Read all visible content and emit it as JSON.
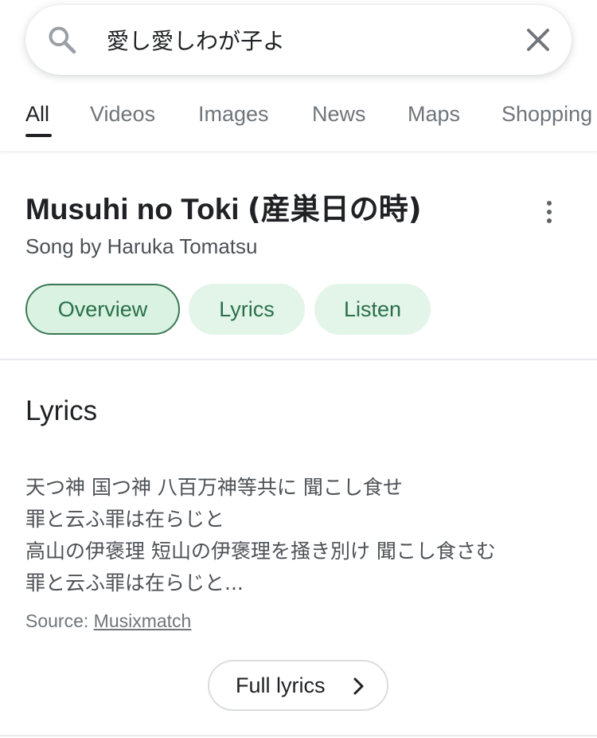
{
  "search": {
    "value": "愛し愛しわが子よ",
    "placeholder": ""
  },
  "tabs": [
    {
      "label": "All",
      "active": true
    },
    {
      "label": "Videos",
      "active": false
    },
    {
      "label": "Images",
      "active": false
    },
    {
      "label": "News",
      "active": false
    },
    {
      "label": "Maps",
      "active": false
    },
    {
      "label": "Shopping",
      "active": false
    }
  ],
  "song": {
    "title_latin": "Musuhi no Toki ",
    "title_cjk": "(産巣日の時)",
    "subtitle": "Song by Haruka Tomatsu"
  },
  "chips": [
    {
      "label": "Overview",
      "selected": true
    },
    {
      "label": "Lyrics",
      "selected": false
    },
    {
      "label": "Listen",
      "selected": false
    }
  ],
  "lyrics": {
    "heading": "Lyrics",
    "lines": [
      "天つ神 国つ神 八百万神等共に 聞こし食せ",
      "罪と云ふ罪は在らじと",
      "高山の伊褒理 短山の伊褒理を掻き別け 聞こし食さむ",
      "罪と云ふ罪は在らじと..."
    ],
    "source_prefix": "Source: ",
    "source_name": "Musixmatch",
    "full_lyrics_label": "Full lyrics"
  },
  "icons": {
    "search": "search-icon",
    "clear": "close-icon",
    "more": "more-vert-icon",
    "chevron": "chevron-right-icon"
  },
  "colors": {
    "chip_bg": "#e3f4e8",
    "chip_text": "#29704a",
    "chip_selected_border": "#3d7757",
    "muted_text": "#70757a"
  }
}
